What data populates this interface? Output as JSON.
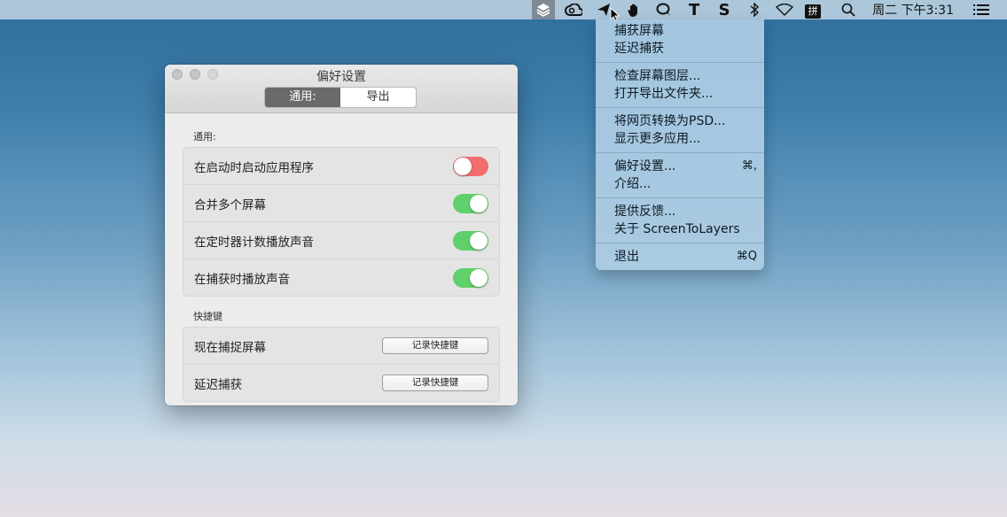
{
  "menubar": {
    "icons": [
      "screentolayers-icon",
      "creative-cloud-icon",
      "paper-plane-icon",
      "hand-icon",
      "chat-bubble-icon",
      "text-t-icon",
      "s-icon",
      "bluetooth-icon",
      "wifi-icon",
      "input-method-icon",
      "search-icon",
      "menu-list-icon"
    ],
    "input_method_label": "拼",
    "clock": "周二 下午3:31"
  },
  "dropdown": {
    "groups": [
      {
        "items": [
          {
            "label": "捕获屏幕"
          },
          {
            "label": "延迟捕获"
          }
        ]
      },
      {
        "items": [
          {
            "label": "检查屏幕图层..."
          },
          {
            "label": "打开导出文件夹..."
          }
        ]
      },
      {
        "items": [
          {
            "label": "将网页转换为PSD..."
          },
          {
            "label": "显示更多应用..."
          }
        ]
      },
      {
        "items": [
          {
            "label": "偏好设置...",
            "shortcut": "⌘,"
          },
          {
            "label": "介绍..."
          }
        ]
      },
      {
        "items": [
          {
            "label": "提供反馈..."
          },
          {
            "label": "关于 ScreenToLayers"
          }
        ]
      },
      {
        "items": [
          {
            "label": "退出",
            "shortcut": "⌘Q"
          }
        ]
      }
    ]
  },
  "window": {
    "title": "偏好设置",
    "tabs": [
      {
        "label": "通用:",
        "active": true
      },
      {
        "label": "导出",
        "active": false
      }
    ],
    "general": {
      "section_label": "通用:",
      "rows": [
        {
          "label": "在启动时启动应用程序",
          "on": false
        },
        {
          "label": "合并多个屏幕",
          "on": true
        },
        {
          "label": "在定时器计数播放声音",
          "on": true
        },
        {
          "label": "在捕获时播放声音",
          "on": true
        }
      ]
    },
    "shortcuts": {
      "section_label": "快捷键",
      "rows": [
        {
          "label": "现在捕捉屏幕",
          "button": "记录快捷键"
        },
        {
          "label": "延迟捕获",
          "button": "记录快捷键"
        }
      ]
    }
  },
  "colors": {
    "toggle_on": "#5fd06a",
    "toggle_off": "#f26d6d",
    "menu_bg": "#afcde4"
  }
}
